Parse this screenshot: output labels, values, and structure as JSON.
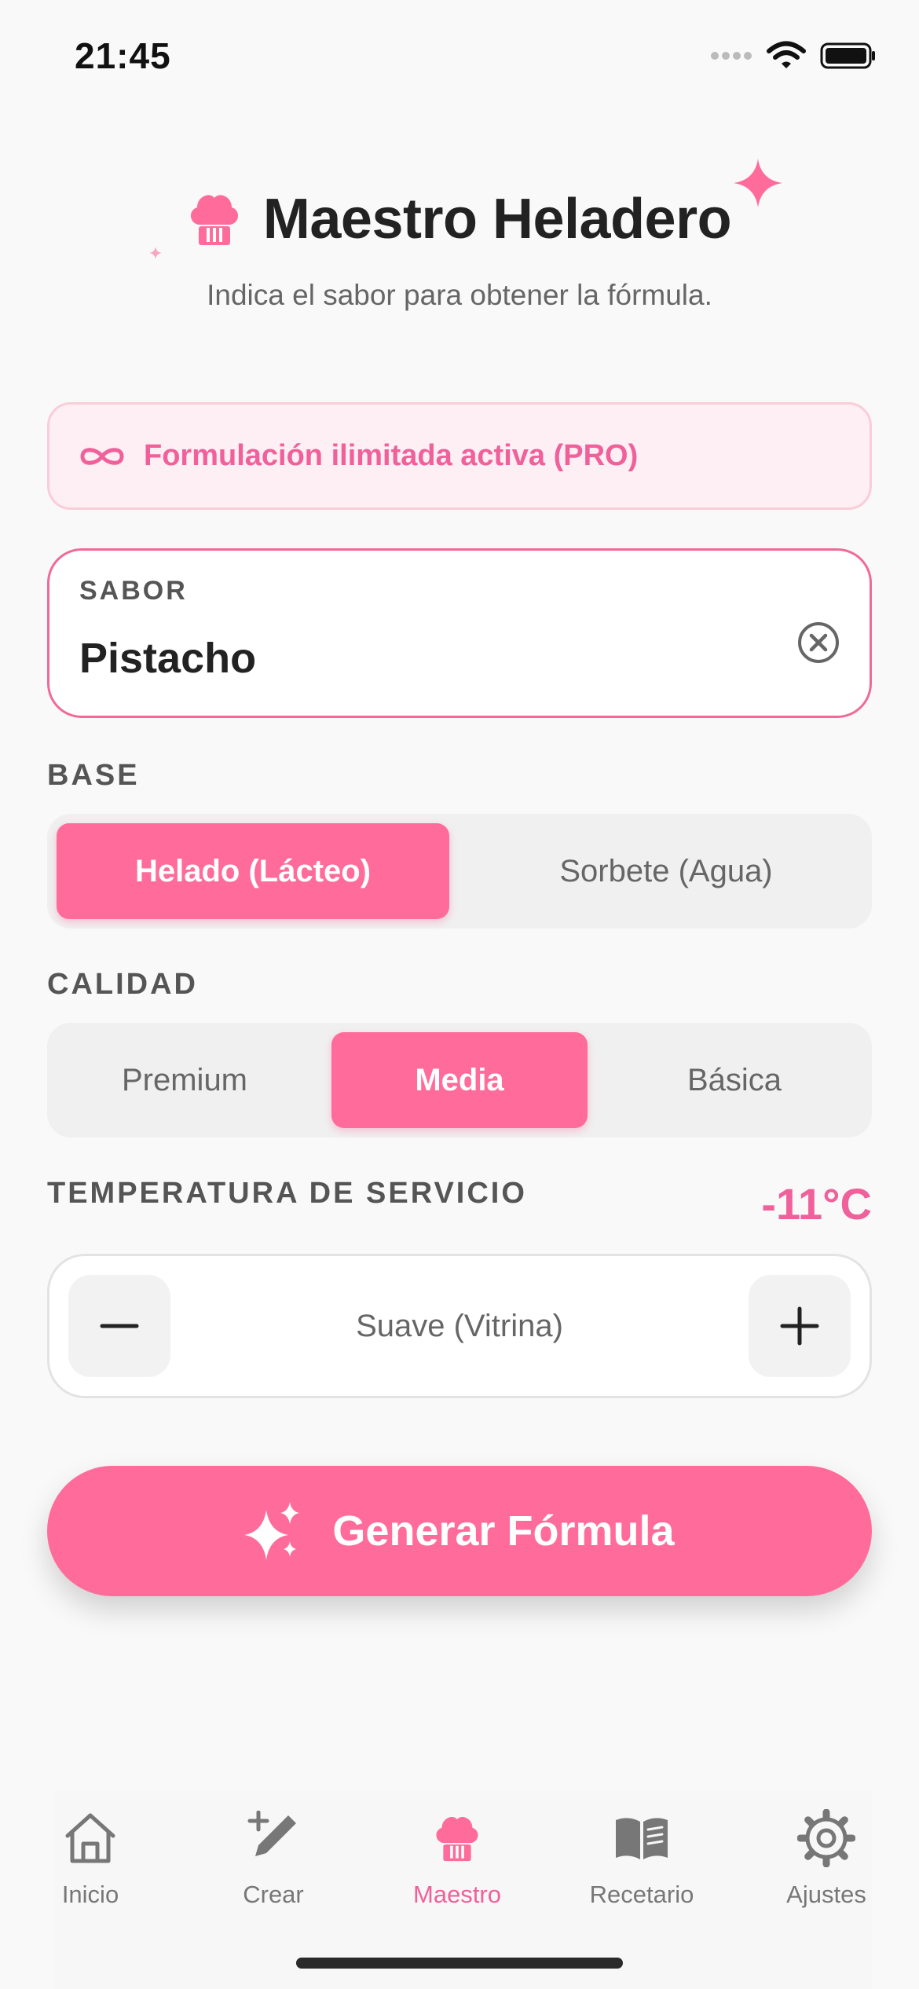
{
  "status_bar": {
    "time": "21:45"
  },
  "header": {
    "title": "Maestro Heladero",
    "subtitle": "Indica el sabor para obtener la fórmula.",
    "icon": "chef-hat-icon"
  },
  "pro_banner": {
    "text": "Formulación ilimitada activa (PRO)",
    "icon": "infinity-icon"
  },
  "flavor": {
    "label": "SABOR",
    "value": "Pistacho"
  },
  "base": {
    "label": "BASE",
    "options": [
      "Helado (Lácteo)",
      "Sorbete (Agua)"
    ],
    "selected": "Helado (Lácteo)"
  },
  "quality": {
    "label": "CALIDAD",
    "options": [
      "Premium",
      "Media",
      "Básica"
    ],
    "selected": "Media"
  },
  "temperature": {
    "label": "TEMPERATURA DE SERVICIO",
    "value": "-11°C",
    "mode": "Suave (Vitrina)"
  },
  "generate_button": {
    "label": "Generar Fórmula"
  },
  "tabbar": {
    "items": [
      {
        "label": "Inicio",
        "icon": "home-icon"
      },
      {
        "label": "Crear",
        "icon": "pencil-sparkle-icon"
      },
      {
        "label": "Maestro",
        "icon": "chef-hat-icon"
      },
      {
        "label": "Recetario",
        "icon": "book-icon"
      },
      {
        "label": "Ajustes",
        "icon": "gear-icon"
      }
    ],
    "active": "Maestro"
  },
  "colors": {
    "accent": "#ff6b9b",
    "accent_text": "#f0609a",
    "background": "#f9f9f9"
  }
}
